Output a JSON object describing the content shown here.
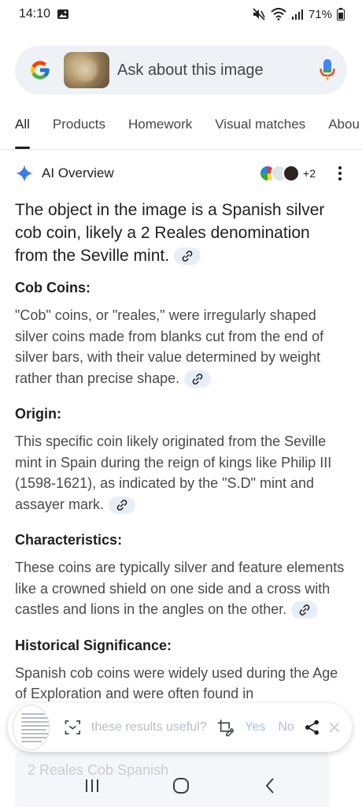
{
  "status_bar": {
    "time": "14:10",
    "battery": "71%"
  },
  "search": {
    "placeholder": "Ask about this image"
  },
  "tabs": [
    {
      "label": "All"
    },
    {
      "label": "Products"
    },
    {
      "label": "Homework"
    },
    {
      "label": "Visual matches"
    },
    {
      "label": "Abou"
    }
  ],
  "ai_overview": {
    "title": "AI Overview",
    "more_sources": "+2",
    "lead": "The object in the image is a Spanish silver cob coin, likely a 2 Reales denomination from the Seville mint.",
    "sections": [
      {
        "heading": "Cob Coins:",
        "text": "\"Cob\" coins, or \"reales,\" were irregularly shaped silver coins made from blanks cut from the end of silver bars, with their value determined by weight rather than precise shape."
      },
      {
        "heading": "Origin:",
        "text": "This specific coin likely originated from the Seville mint in Spain during the reign of kings like Philip III (1598-1621), as indicated by the \"S.D\" mint and assayer mark."
      },
      {
        "heading": "Characteristics:",
        "text": "These coins are typically silver and feature elements like a crowned shield on one side and a cross with castles and lions in the angles on the other."
      },
      {
        "heading": "Historical Significance:",
        "text": "Spanish cob coins were widely used during the Age of Exploration and were often found in"
      }
    ]
  },
  "feedback": {
    "prompt": "these results useful?",
    "yes": "Yes",
    "no": "No"
  },
  "result_card": {
    "title": "2 Reales Cob Spanish"
  },
  "colors": {
    "accent": "#1a73e8",
    "chip_bg": "#e8eef8",
    "search_bg": "#eef1f6"
  }
}
